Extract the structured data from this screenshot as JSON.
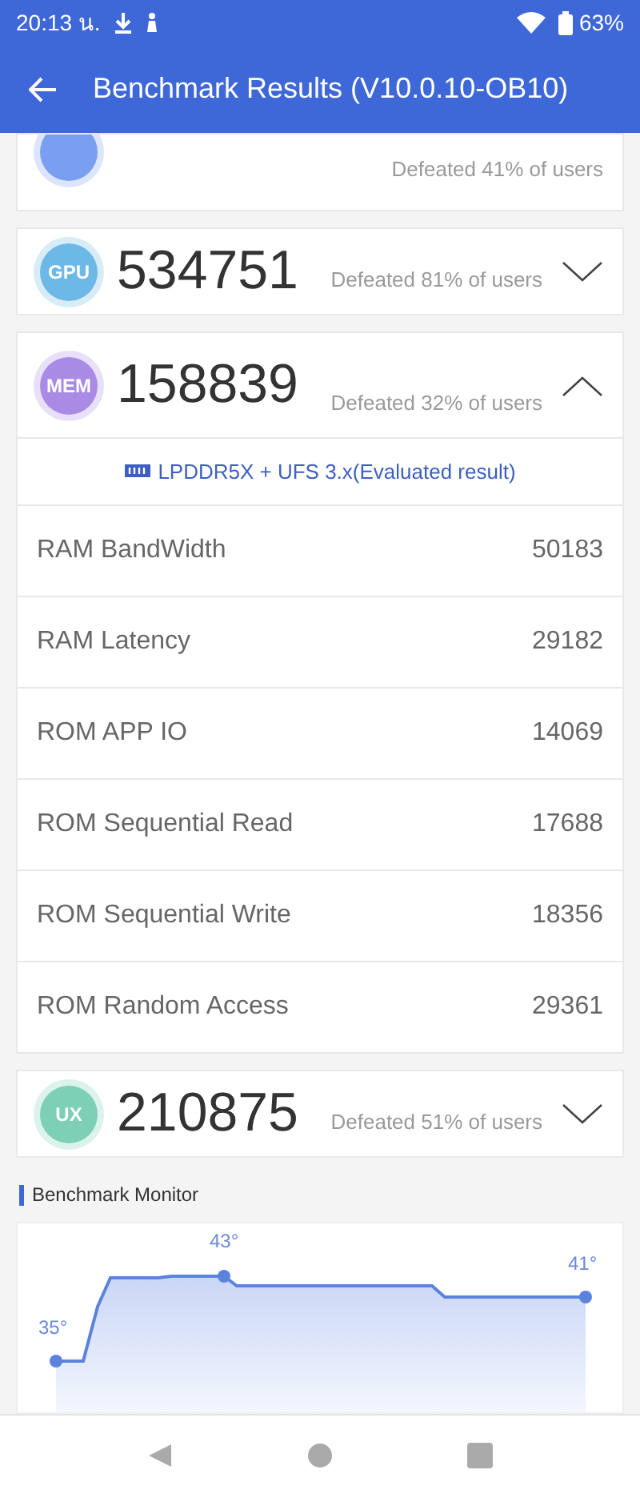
{
  "status_bar": {
    "time": "20:13 น.",
    "battery": "63%"
  },
  "header": {
    "title": "Benchmark Results (V10.0.10-OB10)"
  },
  "scores": [
    {
      "kind": "partial",
      "defeated": "Defeated 41% of users",
      "color": "#7b9ff0"
    },
    {
      "kind": "full",
      "badge": "GPU",
      "score": "534751",
      "defeated": "Defeated 81% of users",
      "color": "#6cb8e6",
      "expanded": false
    },
    {
      "kind": "full",
      "badge": "MEM",
      "score": "158839",
      "defeated": "Defeated 32% of users",
      "color": "#a98be6",
      "expanded": true,
      "memory_type": "LPDDR5X + UFS 3.x(Evaluated result)",
      "details": [
        {
          "name": "RAM BandWidth",
          "value": "50183"
        },
        {
          "name": "RAM Latency",
          "value": "29182"
        },
        {
          "name": "ROM APP IO",
          "value": "14069"
        },
        {
          "name": "ROM Sequential Read",
          "value": "17688"
        },
        {
          "name": "ROM Sequential Write",
          "value": "18356"
        },
        {
          "name": "ROM Random Access",
          "value": "29361"
        }
      ]
    },
    {
      "kind": "full",
      "badge": "UX",
      "score": "210875",
      "defeated": "Defeated 51% of users",
      "color": "#7dcfb6",
      "expanded": false
    }
  ],
  "monitor": {
    "title": "Benchmark Monitor",
    "labels": [
      "35°",
      "43°",
      "41°"
    ]
  }
}
